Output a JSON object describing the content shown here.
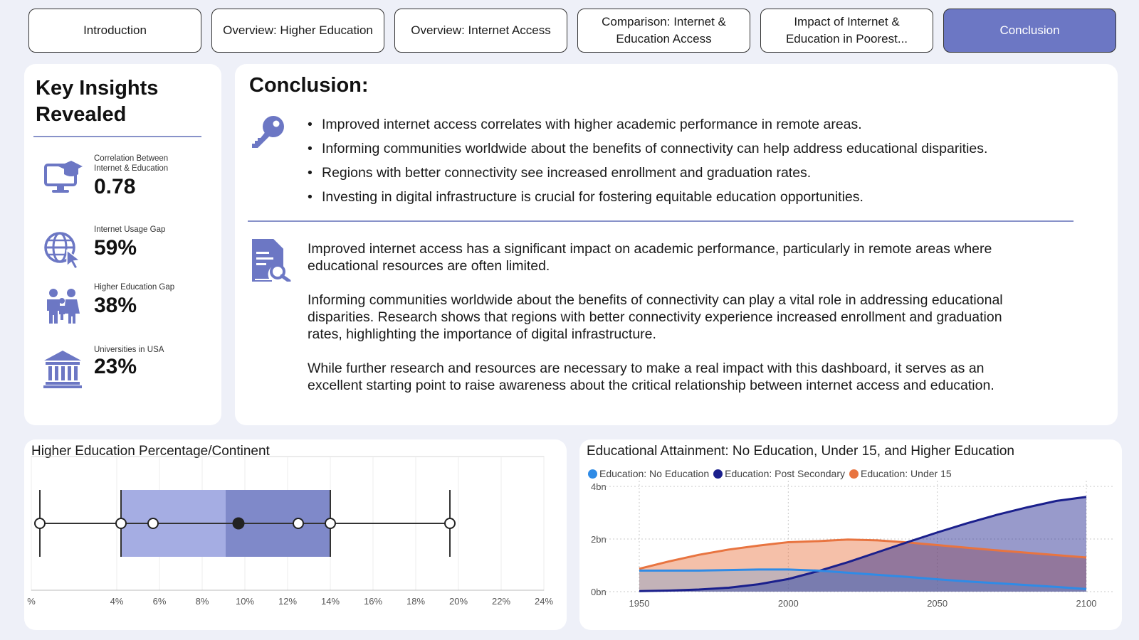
{
  "tabs": [
    {
      "label": "Introduction",
      "active": false
    },
    {
      "label": "Overview: Higher Education",
      "active": false
    },
    {
      "label": "Overview: Internet Access",
      "active": false
    },
    {
      "label": "Comparison: Internet & Education Access",
      "active": false
    },
    {
      "label": "Impact of Internet & Education in Poorest...",
      "active": false
    },
    {
      "label": "Conclusion",
      "active": true
    }
  ],
  "insights": {
    "title": "Key Insights Revealed",
    "kpis": [
      {
        "label": "Correlation Between Internet & Education",
        "value": "0.78",
        "icon": "monitor-graduation-icon"
      },
      {
        "label": "Internet Usage Gap",
        "value": "59%",
        "icon": "globe-cursor-icon"
      },
      {
        "label": "Higher Education Gap",
        "value": "38%",
        "icon": "people-icon"
      },
      {
        "label": "Universities in USA",
        "value": "23%",
        "icon": "university-icon"
      }
    ]
  },
  "conclusion": {
    "title": "Conclusion:",
    "bullets": [
      "Improved internet access correlates with higher academic performance in remote areas.",
      "Informing communities worldwide about the benefits of connectivity can help address educational disparities.",
      "Regions with better connectivity see increased enrollment and graduation rates.",
      "Investing in digital infrastructure is crucial for fostering equitable education opportunities."
    ],
    "paragraphs": [
      "Improved internet access has a significant impact on academic performance, particularly in remote areas where educational resources are often limited.",
      "Informing communities worldwide about the benefits of connectivity can play a vital role in addressing educational disparities. Research shows that regions with better connectivity experience increased enrollment and graduation rates, highlighting the importance of digital infrastructure.",
      "While further research and resources are necessary to make a real impact with this dashboard, it serves as an excellent starting point to raise awareness about the critical relationship between internet access and education."
    ]
  },
  "colors": {
    "accent": "#6c77c4",
    "box_lower": "#a5ade3",
    "box_upper": "#7f89c9",
    "no_education": "#2f8be6",
    "post_secondary": "#1a1f8c",
    "under_15": "#e87440"
  },
  "chart_data": [
    {
      "type": "box",
      "title": "Higher Education Percentage/Continent",
      "xlim": [
        0,
        24
      ],
      "xticks": [
        0,
        4,
        6,
        8,
        10,
        12,
        14,
        16,
        18,
        20,
        22,
        24
      ],
      "xtick_labels": [
        "%",
        "4%",
        "6%",
        "8%",
        "10%",
        "12%",
        "14%",
        "16%",
        "18%",
        "20%",
        "22%",
        "24%"
      ],
      "whisker_low": 0.4,
      "q1": 4.2,
      "median": 9.1,
      "q3": 14.0,
      "whisker_high": 19.6,
      "mean": 9.7,
      "points": [
        0.4,
        4.2,
        5.7,
        12.5,
        14.0,
        19.6
      ],
      "grid": true
    },
    {
      "type": "area",
      "title": "Educational Attainment: No Education, Under 15, and Higher Education",
      "x": [
        1950,
        1960,
        1970,
        1980,
        1990,
        2000,
        2010,
        2020,
        2030,
        2040,
        2050,
        2060,
        2070,
        2080,
        2090,
        2100
      ],
      "xticks": [
        1950,
        2000,
        2050,
        2100
      ],
      "ylim": [
        0,
        4
      ],
      "yticks": [
        0,
        2,
        4
      ],
      "ytick_labels": [
        "0bn",
        "2bn",
        "4bn"
      ],
      "legend_position": "top-left",
      "series": [
        {
          "name": "Education: No Education",
          "values": [
            0.8,
            0.8,
            0.8,
            0.82,
            0.84,
            0.84,
            0.8,
            0.72,
            0.64,
            0.56,
            0.47,
            0.39,
            0.32,
            0.25,
            0.18,
            0.1
          ]
        },
        {
          "name": "Education: Post Secondary",
          "values": [
            0.02,
            0.04,
            0.08,
            0.15,
            0.28,
            0.48,
            0.78,
            1.12,
            1.5,
            1.88,
            2.25,
            2.6,
            2.92,
            3.2,
            3.45,
            3.6
          ]
        },
        {
          "name": "Education: Under 15",
          "values": [
            0.87,
            1.15,
            1.4,
            1.6,
            1.75,
            1.88,
            1.92,
            1.98,
            1.95,
            1.87,
            1.77,
            1.67,
            1.57,
            1.48,
            1.39,
            1.3
          ]
        }
      ]
    }
  ]
}
